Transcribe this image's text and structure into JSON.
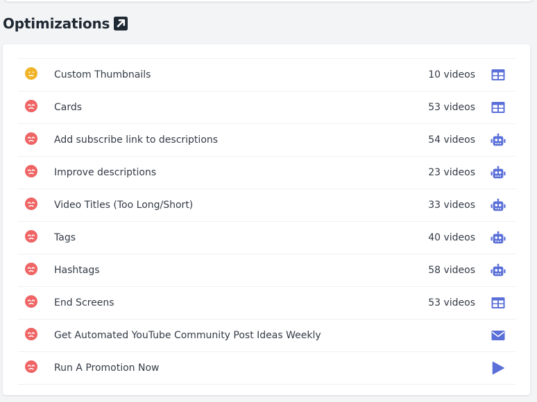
{
  "section": {
    "title": "Optimizations"
  },
  "colors": {
    "neutral_face": "#f0b429",
    "sad_face": "#ef6464",
    "action_icon": "#5a6fd8"
  },
  "optimizations": [
    {
      "label": "Custom Thumbnails",
      "count": "10 videos",
      "status": "neutral",
      "action_icon": "table-icon"
    },
    {
      "label": "Cards",
      "count": "53 videos",
      "status": "poor",
      "action_icon": "table-icon"
    },
    {
      "label": "Add subscribe link to descriptions",
      "count": "54 videos",
      "status": "poor",
      "action_icon": "robot-icon"
    },
    {
      "label": "Improve descriptions",
      "count": "23 videos",
      "status": "poor",
      "action_icon": "robot-icon"
    },
    {
      "label": "Video Titles (Too Long/Short)",
      "count": "33 videos",
      "status": "poor",
      "action_icon": "robot-icon"
    },
    {
      "label": "Tags",
      "count": "40 videos",
      "status": "poor",
      "action_icon": "robot-icon"
    },
    {
      "label": "Hashtags",
      "count": "58 videos",
      "status": "poor",
      "action_icon": "robot-icon"
    },
    {
      "label": "End Screens",
      "count": "53 videos",
      "status": "poor",
      "action_icon": "table-icon"
    },
    {
      "label": "Get Automated YouTube Community Post Ideas Weekly",
      "count": "",
      "status": "poor",
      "action_icon": "envelope-icon"
    },
    {
      "label": "Run A Promotion Now",
      "count": "",
      "status": "poor",
      "action_icon": "play-icon"
    }
  ]
}
